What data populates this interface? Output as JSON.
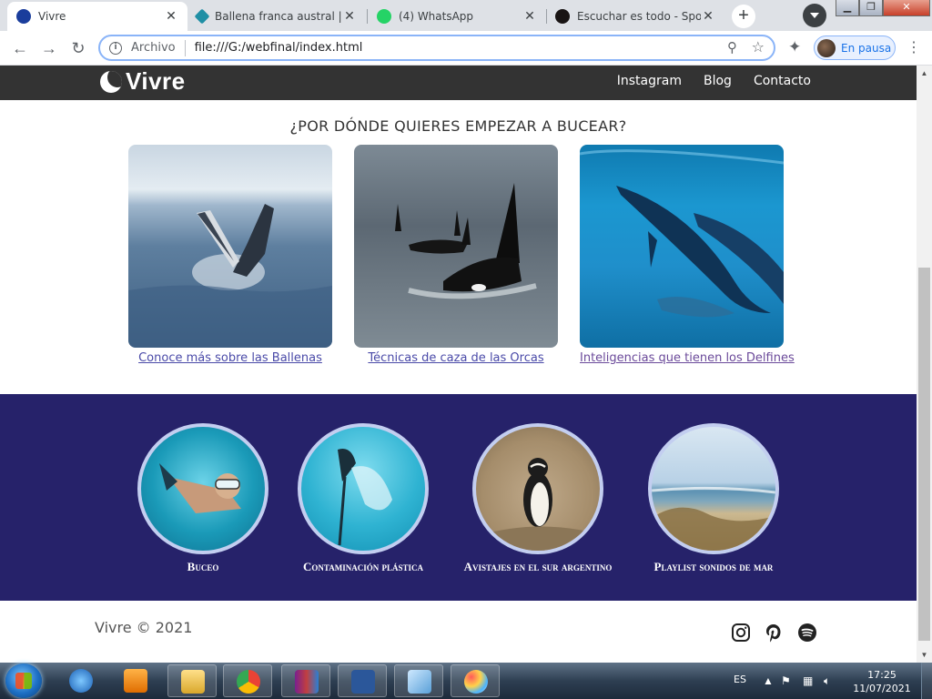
{
  "browser": {
    "tabs": [
      {
        "title": "Vivre",
        "active": true,
        "favicon": "vivre-moon",
        "color": "#1a3d9c"
      },
      {
        "title": "Ballena franca austral | Di",
        "active": false,
        "favicon": "diamond",
        "color": "#1f8fa5"
      },
      {
        "title": "(4) WhatsApp",
        "active": false,
        "favicon": "whatsapp",
        "color": "#25d366"
      },
      {
        "title": "Escuchar es todo - Spotif",
        "active": false,
        "favicon": "spotify",
        "color": "#191414"
      }
    ],
    "new_tab": "+",
    "address": {
      "scheme_label": "Archivo",
      "url": "file:///G:/webfinal/index.html"
    },
    "profile_label": "En pausa"
  },
  "site": {
    "brand": "Vivre",
    "nav": [
      "Instagram",
      "Blog",
      "Contacto"
    ],
    "section_title": "¿POR DÓNDE QUIERES EMPEZAR A BUCEAR?",
    "cards": [
      {
        "caption": "Conoce más sobre las Ballenas",
        "image": "humpback-whale-breaching",
        "visited": false
      },
      {
        "caption": "Técnicas de caza de las Orcas",
        "image": "orcas-swimming",
        "visited": false
      },
      {
        "caption": "Inteligencias que tienen los Delfines",
        "image": "dolphins-underwater",
        "visited": true
      }
    ],
    "circles": [
      {
        "label": "Buceo",
        "image": "snorkel-diver"
      },
      {
        "label": "Contaminación plástica",
        "image": "ray-plastic-bag"
      },
      {
        "label": "Avistajes en el sur argentino",
        "image": "magellanic-penguin"
      },
      {
        "label": "Playlist sonidos de mar",
        "image": "beach-dunes"
      }
    ],
    "footer": {
      "copyright": "Vivre © 2021",
      "social": [
        "instagram-icon",
        "pinterest-icon",
        "spotify-icon"
      ]
    },
    "colors": {
      "header": "#333333",
      "band": "#26226a",
      "ring": "#c3cef0",
      "link": "#4a4aa8"
    }
  },
  "taskbar": {
    "language": "ES",
    "time": "17:25",
    "date": "11/07/2021",
    "apps": [
      "internet-explorer",
      "media-player",
      "file-explorer",
      "chrome",
      "winrar",
      "word",
      "notepad-blue",
      "paint"
    ]
  }
}
